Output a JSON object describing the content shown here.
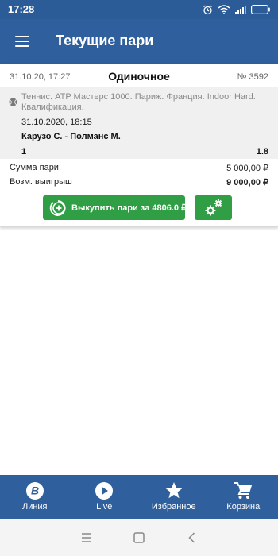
{
  "status_bar": {
    "time": "17:28",
    "icons": [
      "alarm-icon",
      "wifi-icon",
      "signal-icon",
      "battery-icon"
    ]
  },
  "app_bar": {
    "title": "Текущие пари",
    "menu_icon": "hamburger-menu-icon"
  },
  "bet": {
    "date": "31.10.20, 17:27",
    "type": "Одиночное",
    "number": "№ 3592",
    "event": {
      "sport_icon": "tennis-ball-icon",
      "league": "Теннис. ATP Мастерс 1000. Париж. Франция. Indoor Hard. Квалификация.",
      "datetime": "31.10.2020, 18:15",
      "teams": "Карузо С. - Полманс М.",
      "pick": "1",
      "odds": "1.8"
    },
    "sum_label": "Сумма пари",
    "sum_value": "5 000,00 ₽",
    "win_label": "Возм. выигрыш",
    "win_value": "9 000,00 ₽",
    "buyout_label": "Выкупить пари за 4806.0 ₽",
    "settings_icon": "gears-icon"
  },
  "bottom_nav": [
    {
      "label": "Линия",
      "icon": "line-b-icon"
    },
    {
      "label": "Live",
      "icon": "play-icon"
    },
    {
      "label": "Избранное",
      "icon": "star-icon"
    },
    {
      "label": "Корзина",
      "icon": "cart-icon"
    }
  ],
  "system_nav": [
    "recent-apps-icon",
    "home-icon",
    "back-icon"
  ],
  "colors": {
    "primary": "#2f5f9c",
    "accent_green": "#2f9e45",
    "event_background": "#f0f0f0"
  }
}
